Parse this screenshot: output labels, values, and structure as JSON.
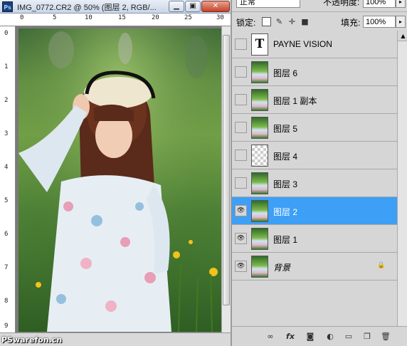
{
  "document": {
    "app_icon": "Ps",
    "title": "IMG_0772.CR2 @ 50% (图层 2, RGB/...",
    "buttons": {
      "minimize": "▁",
      "restore": "▣",
      "close": "✕"
    },
    "ruler_h": [
      "0",
      "5",
      "10",
      "15",
      "20",
      "25",
      "30"
    ],
    "ruler_v": [
      "0",
      "1",
      "2",
      "3",
      "4",
      "5",
      "6",
      "7",
      "8",
      "9"
    ],
    "watermark": "PSwarefon.cn"
  },
  "layers_panel": {
    "blend_mode": "正常",
    "opacity_label": "不透明度:",
    "opacity_value": "100%",
    "lock_label": "锁定:",
    "fill_label": "填充:",
    "fill_value": "100%",
    "layers": [
      {
        "name": "PAYNE VISION",
        "thumb": "T",
        "visible": false,
        "selected": false
      },
      {
        "name": "图层 6",
        "visible": false,
        "selected": false
      },
      {
        "name": "图层 1 副本",
        "visible": false,
        "selected": false
      },
      {
        "name": "图层 5",
        "visible": false,
        "selected": false
      },
      {
        "name": "图层 4",
        "visible": false,
        "selected": false
      },
      {
        "name": "图层 3",
        "visible": false,
        "selected": false
      },
      {
        "name": "图层 2",
        "visible": true,
        "selected": true
      },
      {
        "name": "图层 1",
        "visible": true,
        "selected": false
      },
      {
        "name": "背景",
        "visible": true,
        "selected": false,
        "locked": true
      }
    ],
    "bottom_icons": [
      "link-icon",
      "fx-icon",
      "mask-icon",
      "adjustment-icon",
      "group-icon",
      "new-layer-icon",
      "trash-icon"
    ],
    "bottom_labels": {
      "fx": "fx"
    }
  },
  "colors": {
    "selection": "#3d9ff5",
    "panel": "#d6d6d6"
  }
}
